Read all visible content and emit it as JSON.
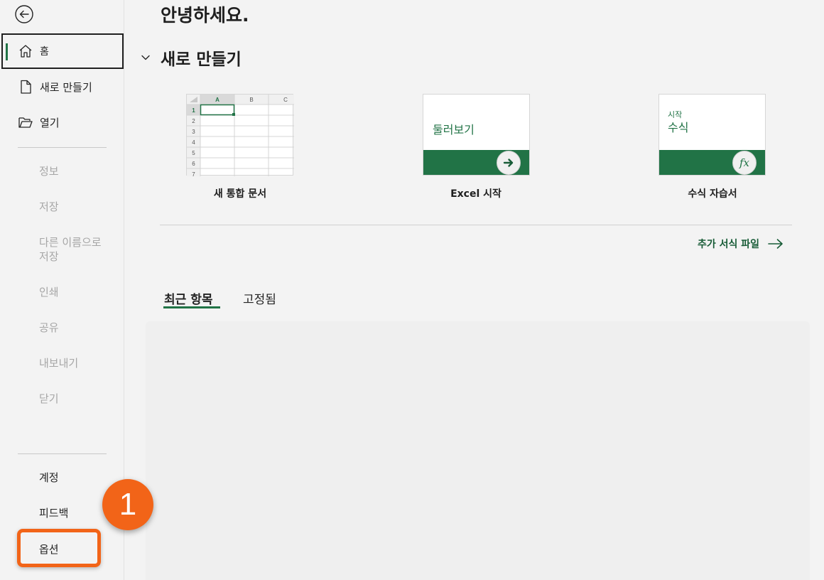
{
  "greeting": "안녕하세요.",
  "new_section": {
    "title": "새로 만들기"
  },
  "sidebar": {
    "home": "홈",
    "new": "새로 만들기",
    "open": "열기",
    "disabled_items": [
      "정보",
      "저장",
      "다른 이름으로",
      "저장",
      "인쇄",
      "공유",
      "내보내기",
      "닫기"
    ],
    "account": "계정",
    "feedback": "피드백",
    "options": "옵션"
  },
  "templates": [
    {
      "label": "새 통합 문서",
      "grid_cols": [
        "A",
        "B",
        "C"
      ],
      "grid_rows": [
        "1",
        "2",
        "3",
        "4",
        "5",
        "6",
        "7"
      ]
    },
    {
      "label": "Excel 시작",
      "tile_text": "둘러보기"
    },
    {
      "label": "수식 자습서",
      "tile_small": "시작",
      "tile_text": "수식",
      "tile_icon": "fx"
    }
  ],
  "more_templates": "추가 서식 파일",
  "tabs": {
    "recent": "최근 항목",
    "pinned": "고정됨"
  },
  "annotation": {
    "step_number": "1"
  },
  "colors": {
    "accent": "#217346",
    "annotation": "#f26418"
  }
}
